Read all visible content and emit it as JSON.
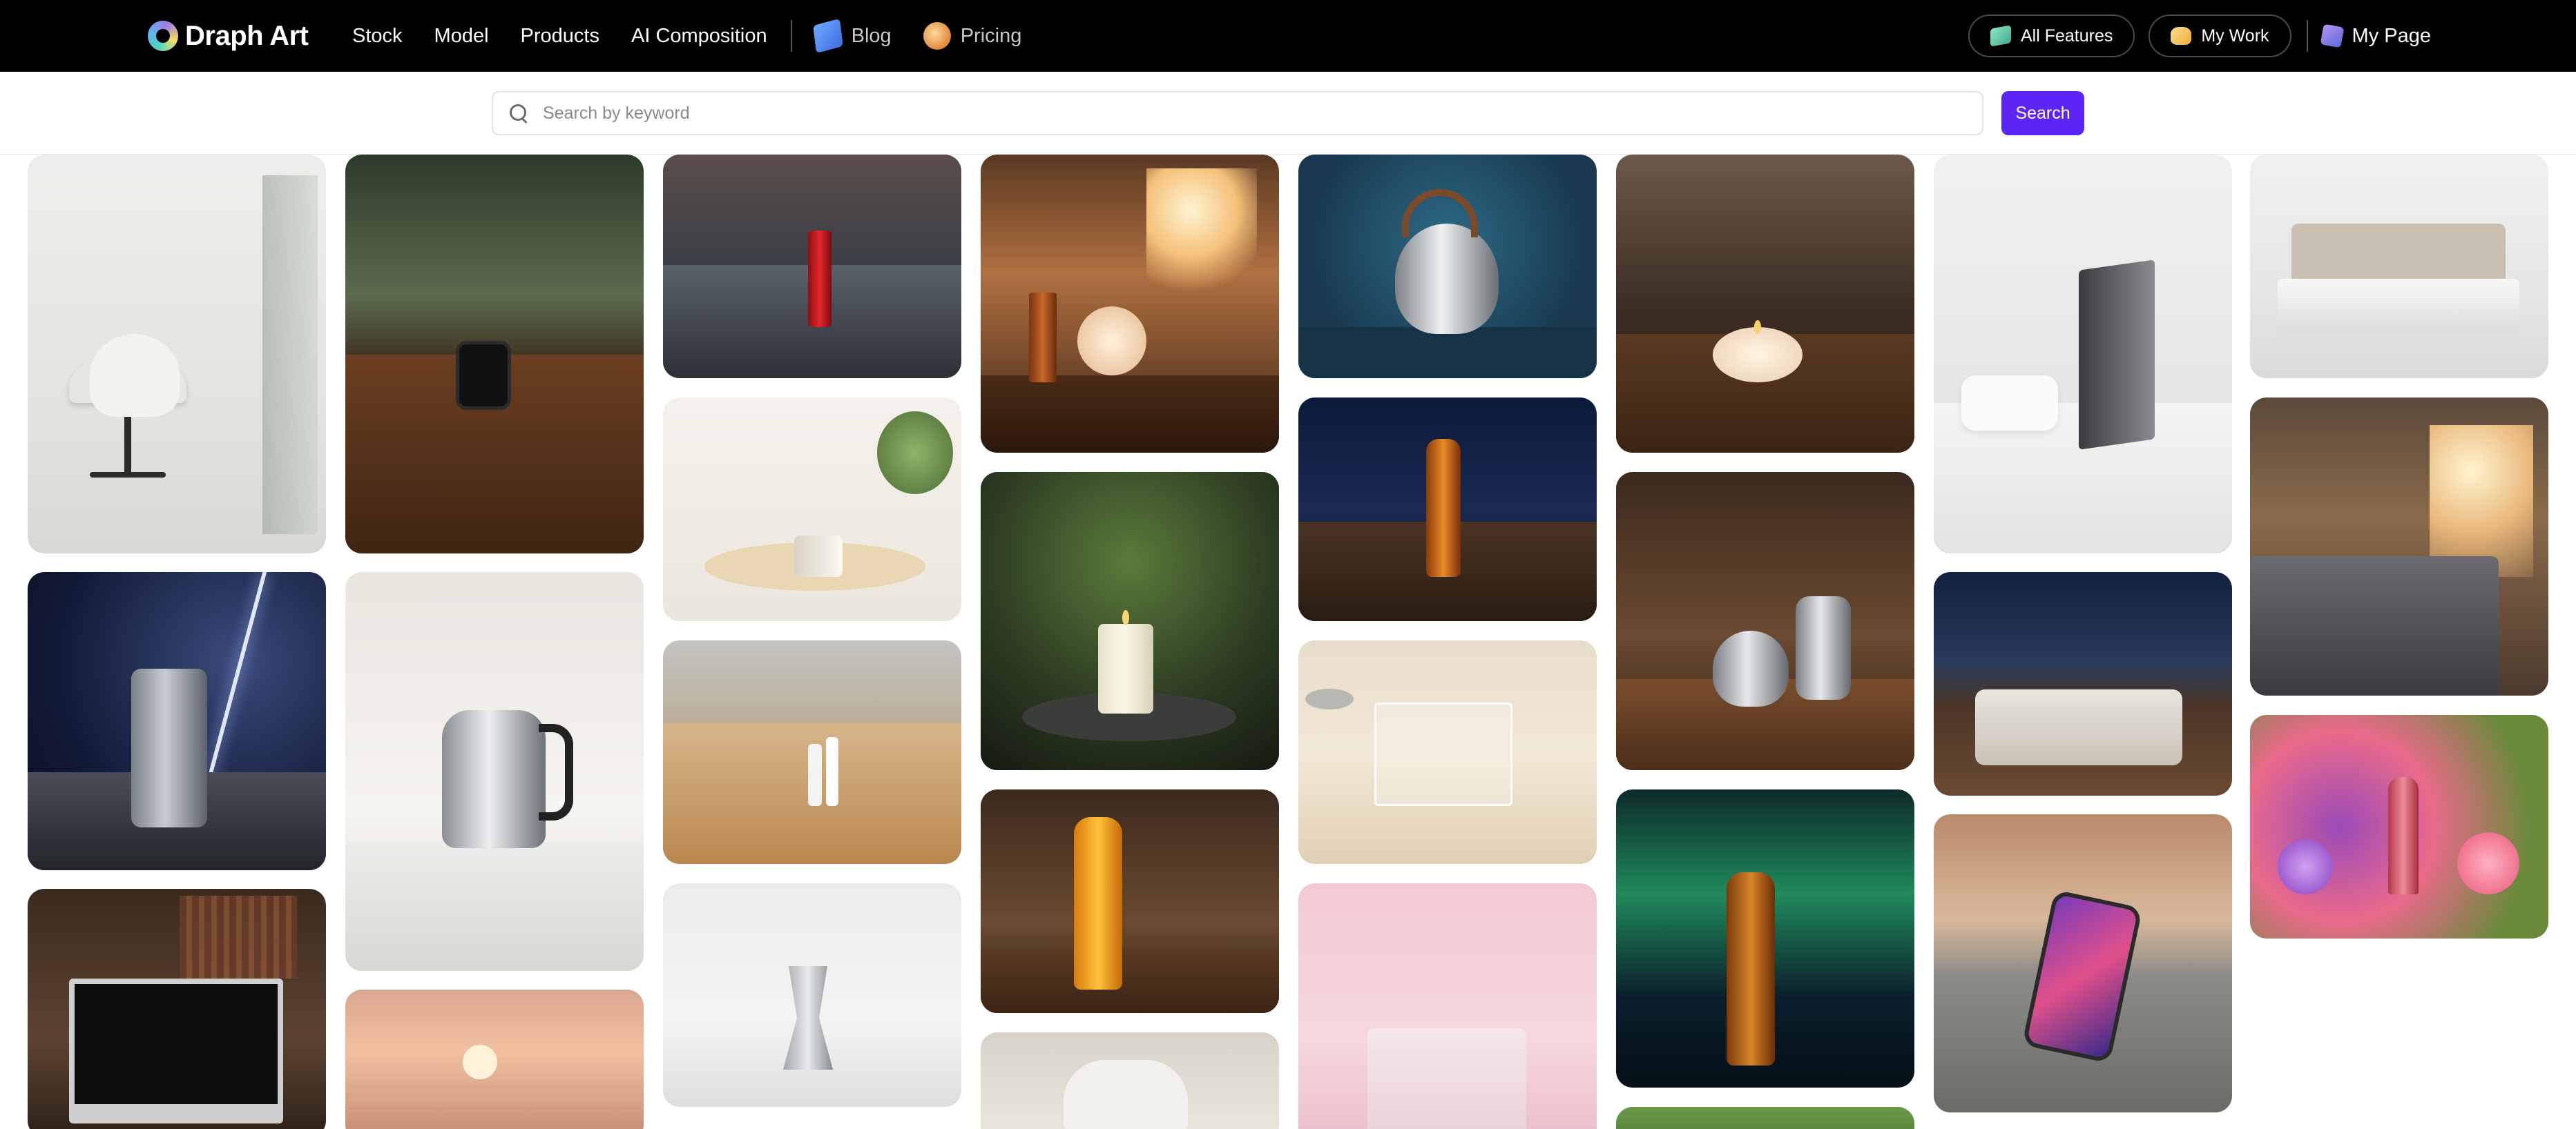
{
  "navbar": {
    "brand": "Draph Art",
    "links": [
      "Stock",
      "Model",
      "Products",
      "AI Composition"
    ],
    "blog": "Blog",
    "pricing": "Pricing",
    "all_features": "All Features",
    "my_work": "My Work",
    "my_page": "My Page"
  },
  "search": {
    "placeholder": "Search by keyword",
    "button": "Search"
  },
  "gallery": {
    "items": [
      "office-chair",
      "lightning-can",
      "imac-desk",
      "smartwatch-table",
      "electric-kettle",
      "sunset-hills",
      "street-lip-balm",
      "cosmetic-jar",
      "lip-balm-sticks",
      "moka-pot",
      "amber-drink-window",
      "candle-bonsai",
      "orange-juice-bottle",
      "white-chair",
      "steaming-kettle",
      "beer-night-balcony",
      "acrylic-box",
      "pink-box",
      "cafe-candle",
      "twin-kettles",
      "beer-aurora",
      "green-tree",
      "monitor-living-room",
      "bedroom-night",
      "smartphone-plaza",
      "upholstered-bed",
      "unmade-bed-sunlight",
      "lipstick-flowers"
    ]
  }
}
